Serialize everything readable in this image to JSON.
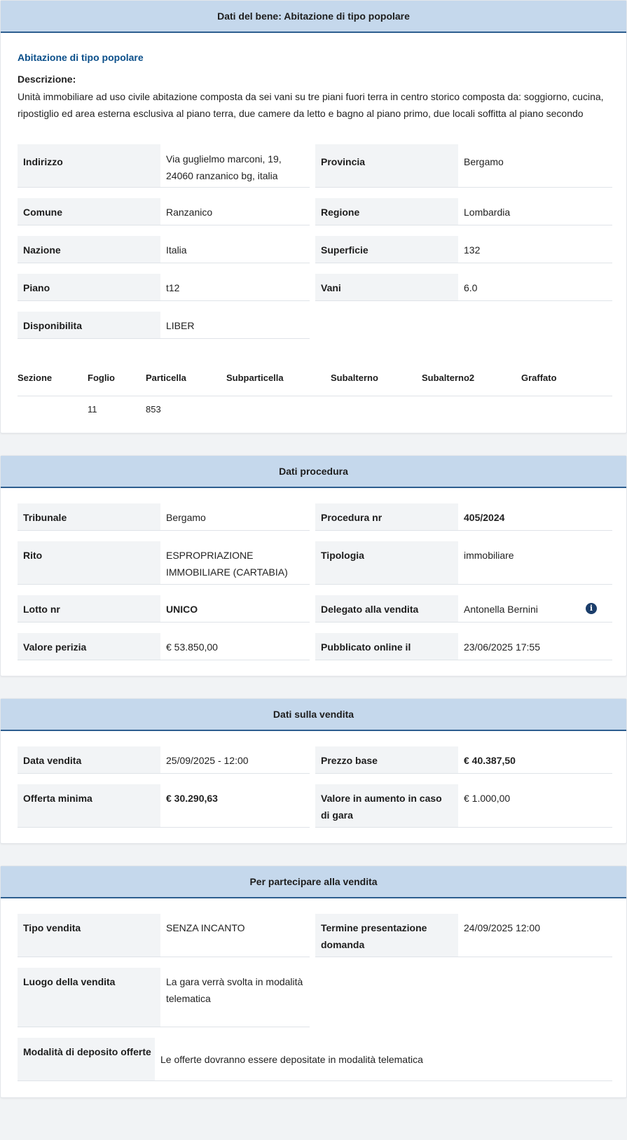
{
  "bene": {
    "header": "Dati del bene: Abitazione di tipo popolare",
    "title": "Abitazione di tipo popolare",
    "desc_label": "Descrizione:",
    "desc_text": "Unità immobiliare ad uso civile abitazione composta da sei vani su tre piani fuori terra in centro storico composta da: soggiorno, cucina, ripostiglio ed area esterna esclusiva al piano terra, due camere da letto e bagno al piano primo, due locali soffitta al piano secondo",
    "fields": {
      "indirizzo_label": "Indirizzo",
      "indirizzo_value": "Via guglielmo marconi, 19, 24060 ranzanico bg, italia",
      "provincia_label": "Provincia",
      "provincia_value": "Bergamo",
      "comune_label": "Comune",
      "comune_value": "Ranzanico",
      "regione_label": "Regione",
      "regione_value": "Lombardia",
      "nazione_label": "Nazione",
      "nazione_value": "Italia",
      "superficie_label": "Superficie",
      "superficie_value": "132",
      "piano_label": "Piano",
      "piano_value": "t12",
      "vani_label": "Vani",
      "vani_value": "6.0",
      "disponibilita_label": "Disponibilita",
      "disponibilita_value": "LIBER"
    },
    "catasto": {
      "headers": [
        "Sezione",
        "Foglio",
        "Particella",
        "Subparticella",
        "Subalterno",
        "Subalterno2",
        "Graffato"
      ],
      "row": [
        "",
        "11",
        "853",
        "",
        "",
        "",
        ""
      ]
    }
  },
  "procedura": {
    "header": "Dati procedura",
    "tribunale_label": "Tribunale",
    "tribunale_value": "Bergamo",
    "procedura_nr_label": "Procedura nr",
    "procedura_nr_value": "405/2024",
    "rito_label": "Rito",
    "rito_value": "ESPROPRIAZIONE IMMOBILIARE (CARTABIA)",
    "tipologia_label": "Tipologia",
    "tipologia_value": "immobiliare",
    "lotto_label": "Lotto nr",
    "lotto_value": "UNICO",
    "delegato_label": "Delegato alla vendita",
    "delegato_value": "Antonella Bernini",
    "valore_perizia_label": "Valore perizia",
    "valore_perizia_value": "€ 53.850,00",
    "pubblicato_label": "Pubblicato online il",
    "pubblicato_value": "23/06/2025 17:55"
  },
  "vendita": {
    "header": "Dati sulla vendita",
    "data_vendita_label": "Data vendita",
    "data_vendita_value": "25/09/2025 - 12:00",
    "prezzo_base_label": "Prezzo base",
    "prezzo_base_value": "€ 40.387,50",
    "offerta_minima_label": "Offerta minima",
    "offerta_minima_value": "€ 30.290,63",
    "aumento_label": "Valore in aumento in caso di gara",
    "aumento_value": "€ 1.000,00"
  },
  "partecipare": {
    "header": "Per partecipare alla vendita",
    "tipo_vendita_label": "Tipo vendita",
    "tipo_vendita_value": "SENZA INCANTO",
    "termine_label": "Termine presentazione domanda",
    "termine_value": "24/09/2025 12:00",
    "luogo_label": "Luogo della vendita",
    "luogo_value": "La gara verrà svolta in modalità telematica",
    "modalita_label": "Modalità di deposito offerte",
    "modalita_value": "Le offerte dovranno essere depositate in modalità telematica"
  },
  "icons": {
    "info": "info-circle-icon"
  },
  "colors": {
    "header_bg": "#c5d8ec",
    "header_border": "#2d5e8f",
    "link_blue": "#0b4f8a",
    "label_bg": "#f2f4f6"
  }
}
